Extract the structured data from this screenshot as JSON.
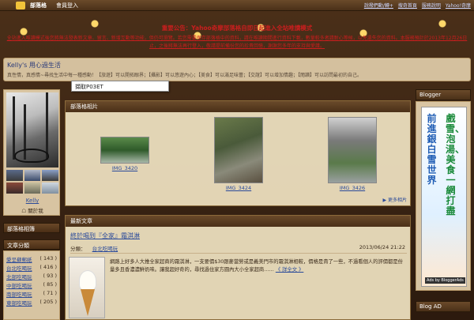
{
  "topbar": {
    "brand": "部落格",
    "login": "會員登入",
    "right_links": [
      "說撥們動/轉+",
      "搜奇首頁",
      "服務說明",
      "Yahoo!奇摩"
    ]
  },
  "notice": {
    "title": "重要公告：Yahoo奇摩部落格自即日起進入全站唯讀模式",
    "body": "全站進入唯讀模式後您將無法發表新文章、留言、新增互動等功能，但仍可瀏覽。若您需要保存部落格中的資料，請在唯讀期間進行資料下載，數量較多者請耐心等候，以免遺失您的資料。本服務預計於2013年12月26日止，之後將無法再行登入，敬請提前備份您的珍貴回憶，謝謝您多年的支持與愛護。"
  },
  "blog": {
    "title": "Kelly's 用心過生活",
    "description": "真性情，真感情~尋找生活中每一種感動！【旅遊】可以開拓眼界；【攝影】可以悠遊內心；【美食】可以滿足味蕾；【交誼】可以增加情趣；【閱讀】可以訪問最初的自己。"
  },
  "tooltip": "擷取P03ET",
  "profile": {
    "name": "Kelly",
    "link": "☖ 關於我"
  },
  "sidebar": {
    "album_title": "部落格相簿",
    "categories_title": "文章分類",
    "categories": [
      {
        "name": "愛呈蘇郵紙",
        "count": "( 143 )"
      },
      {
        "name": "台北吃喝玩",
        "count": "( 416 )"
      },
      {
        "name": "北部吃喝玩",
        "count": "( 93 )"
      },
      {
        "name": "中部吃喝玩",
        "count": "( 85 )"
      },
      {
        "name": "南部吃喝玩",
        "count": "( 71 )"
      },
      {
        "name": "東部吃喝玩",
        "count": "( 205 )"
      }
    ]
  },
  "album": {
    "header": "部落格相片",
    "photos": [
      {
        "caption": "IMG_3420"
      },
      {
        "caption": "IMG_3424"
      },
      {
        "caption": "IMG_3426"
      }
    ],
    "more": "▶ 更多相片"
  },
  "latest": {
    "header": "最新文章",
    "post_title": "終於喝到『全家』霜淇淋",
    "category_label": "分類：",
    "category": "台北吃喝玩",
    "date": "2013/06/24 21:22",
    "body": "網路上好多人大推全家超商的霜淇淋，一支要價$30跟麥當勞或是義美門市的霜淇淋相較，價格是貴了一些，不過看個人的評價都是份量多且香濃濃鮮奶味。讓我超好奇的，尋找過住家方圓內大小全家超商……",
    "readmore": "《 詳全文 》"
  },
  "right": {
    "blogger_title": "Blogger",
    "ad_left": "前進銀白雪世界",
    "ad_right": "戲雪、泡湯、美食一網打盡",
    "ad_by": "Ads by BloggerAds",
    "blogad_title": "Blog AD"
  }
}
